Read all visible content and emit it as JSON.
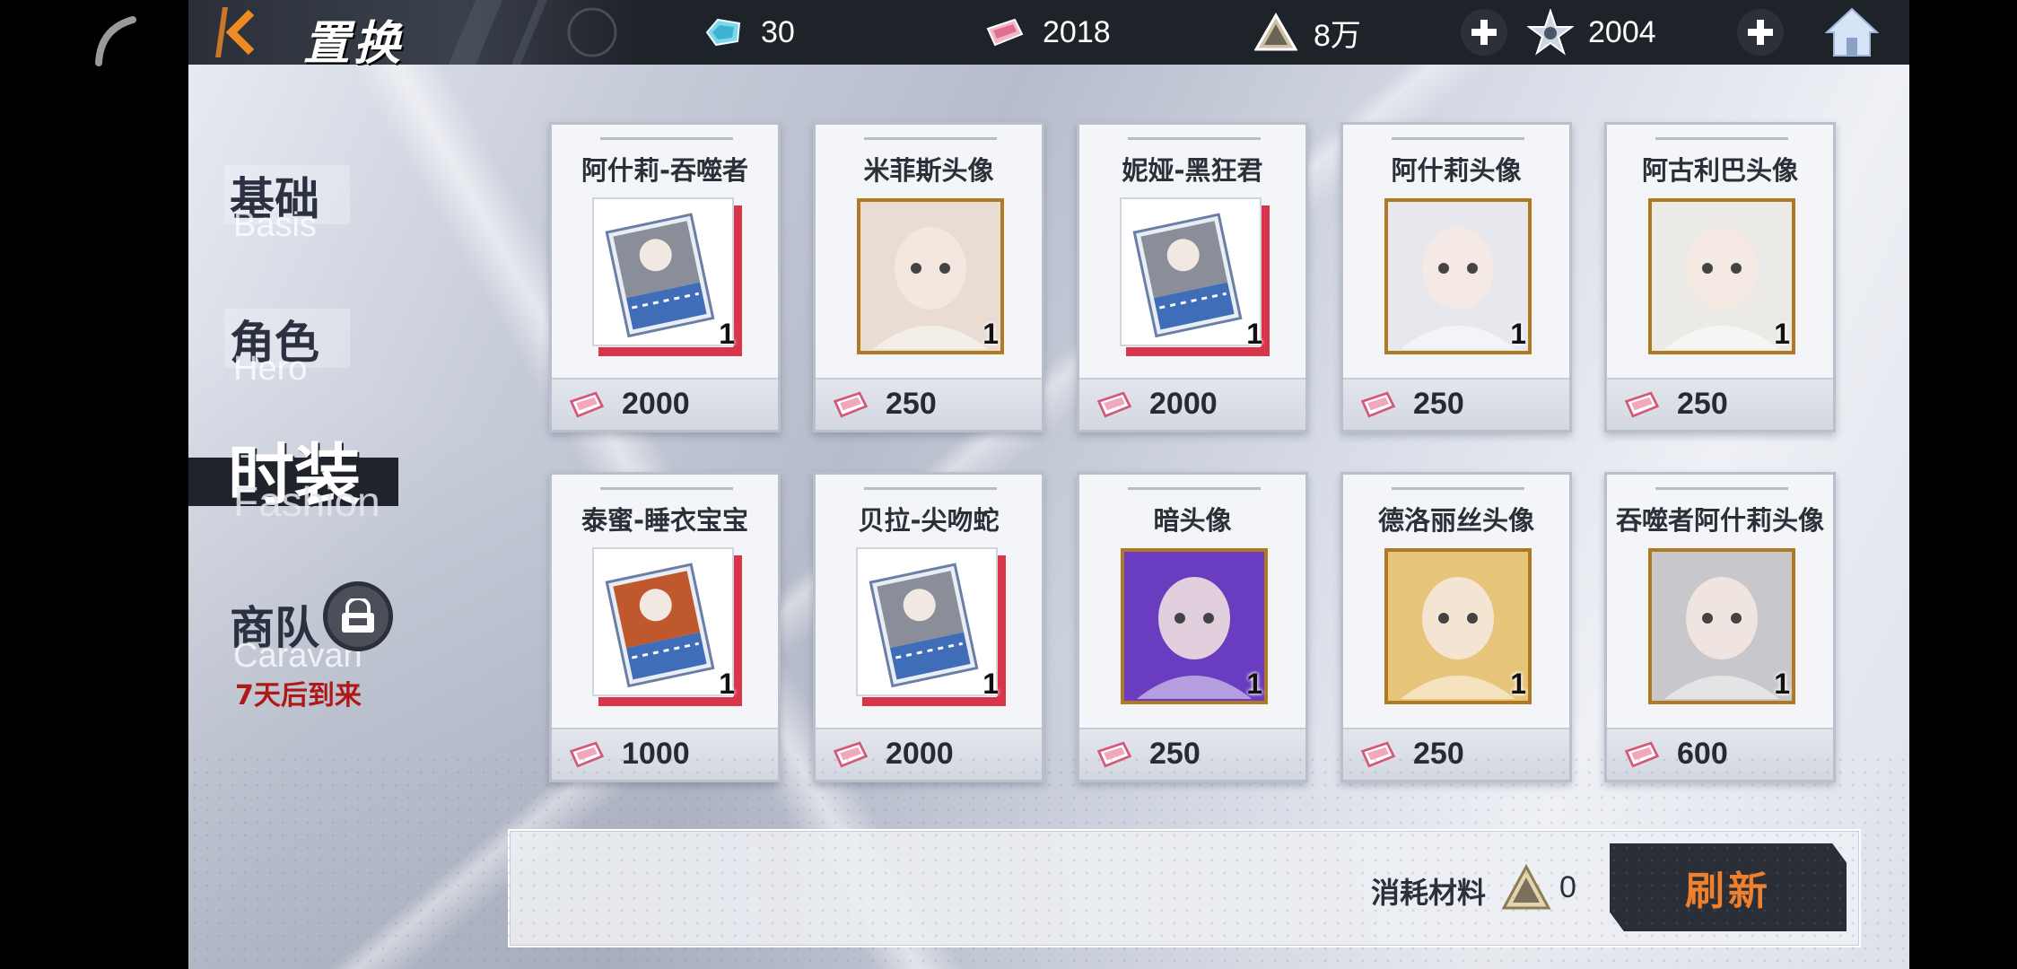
{
  "header": {
    "title": "置换",
    "resources": [
      {
        "icon": "crystal-icon",
        "value": "30"
      },
      {
        "icon": "ticket-icon",
        "value": "2018"
      },
      {
        "icon": "material-triangle-icon",
        "value": "8万"
      },
      {
        "icon": "star-coin-icon",
        "value": "2004"
      }
    ]
  },
  "sidebar": {
    "items": [
      {
        "label": "基础",
        "en": "Basis"
      },
      {
        "label": "角色",
        "en": "Hero"
      },
      {
        "label": "时装",
        "en": "Fashion"
      },
      {
        "label": "商队",
        "en": "Caravan",
        "note": "7天后到来"
      }
    ]
  },
  "items": [
    {
      "name": "阿什莉-吞噬者",
      "qty": "1",
      "price": "2000",
      "type": "card",
      "accent": "#8a8e98"
    },
    {
      "name": "米菲斯头像",
      "qty": "1",
      "price": "250",
      "type": "portrait",
      "accent": "#e9dcd2"
    },
    {
      "name": "妮娅-黑狂君",
      "qty": "1",
      "price": "2000",
      "type": "card",
      "accent": "#8a8e98"
    },
    {
      "name": "阿什莉头像",
      "qty": "1",
      "price": "250",
      "type": "portrait",
      "accent": "#e6e8ee"
    },
    {
      "name": "阿古利巴头像",
      "qty": "1",
      "price": "250",
      "type": "portrait",
      "accent": "#eceae6"
    },
    {
      "name": "泰蜜-睡衣宝宝",
      "qty": "1",
      "price": "1000",
      "type": "card",
      "accent": "#c0582e"
    },
    {
      "name": "贝拉-尖吻蛇",
      "qty": "1",
      "price": "2000",
      "type": "card",
      "accent": "#8a8e98"
    },
    {
      "name": "暗头像",
      "qty": "1",
      "price": "250",
      "type": "portrait",
      "accent": "#6a3cc0"
    },
    {
      "name": "德洛丽丝头像",
      "qty": "1",
      "price": "250",
      "type": "portrait",
      "accent": "#e6c57a"
    },
    {
      "name": "吞噬者阿什莉头像",
      "qty": "1",
      "price": "600",
      "type": "portrait",
      "accent": "#c8c8cc"
    }
  ],
  "footer": {
    "cost_label": "消耗材料",
    "cost_value": "0",
    "refresh_label": "刷新"
  },
  "colors": {
    "accent_orange": "#f0802c",
    "card_red": "#d8344a",
    "frame_gold": "#b07a24",
    "topbar": "#1e2229"
  }
}
